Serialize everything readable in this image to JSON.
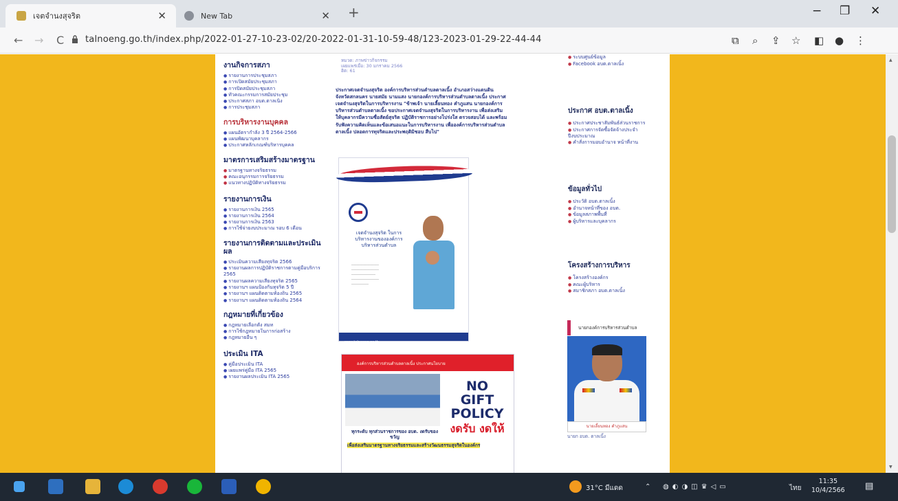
{
  "browser": {
    "tabs": [
      {
        "title": "เจตจำนงสุจริต"
      },
      {
        "title": "New Tab"
      }
    ],
    "new_tab_symbol": "+",
    "url": "talnoeng.go.th/index.php/2022-01-27-10-23-02/20-2022-01-31-10-59-48/123-2023-01-29-22-44-44",
    "nav": {
      "back": "←",
      "forward": "→",
      "reload": "C"
    },
    "window": {
      "minimize": "−",
      "maximize": "❐",
      "close": "✕"
    },
    "toolbar_icons": [
      "translate-icon",
      "zoom-icon",
      "share-icon",
      "bookmark-star-icon",
      "sidebar-icon",
      "profile-icon",
      "menu-icon"
    ]
  },
  "left_column": {
    "sections": [
      {
        "heading": "งานกิจการสภา",
        "links": [
          "รายงานการประชุมสภา",
          "การเปิดสมัยประชุมสภา",
          "การปิดสมัยประชุมสภา",
          "ทั่วคณะกรรมการสมัยประชุม",
          "ประกาศสภา อบต.ตาลเนิ้ง",
          "การประชุมสภา"
        ]
      },
      {
        "heading": "การบริหารงานบุคคล",
        "red": true,
        "links": [
          "แผนอัตรากำลัง 3 ปี 2564-2566",
          "แผนพัฒนาบุคลากร",
          "ประกาศหลักเกณฑ์บริหารบุคคล"
        ]
      },
      {
        "heading": "มาตรการเสริมสร้างมาตรฐาน",
        "links": [
          "มาตรฐานทางจริยธรรม",
          "คณะอนุกรรมการจริยธรรม",
          "แนวทางปฏิบัติทางจริยธรรม"
        ],
        "red_bullets": true
      },
      {
        "heading": "รายงานการเงิน",
        "links": [
          "รายงานการเงิน 2565",
          "รายงานการเงิน 2564",
          "รายงานการเงิน 2563",
          "การใช้จ่ายงบประมาณ รอบ 6 เดือน"
        ]
      },
      {
        "heading": "รายงานการติดตามและประเมินผล",
        "links": [
          "ประเมินความเสี่ยงทุจริต 2566",
          "รายงานผลการปฏิบัติราชการตามคู่มือบริการ 2565",
          "รายงานผลความเสี่ยงทุจริต 2565",
          "รายงานฯ แผนป้องกันทุจริต 5 ปี",
          "รายงานฯ แผนติดตามท้องถิ่น 2565",
          "รายงานฯ แผนติดตามท้องถิ่น 2564"
        ]
      },
      {
        "heading": "กฎหมายที่เกี่ยวข้อง",
        "links": [
          "กฎหมายเลือกตั้ง สมท",
          "การใช้กฎหมายในการก่อสร้าง",
          "กฎหมายอื่น ๆ"
        ]
      },
      {
        "heading": "ประเมิน ITA",
        "links": [
          "คู่มือประเมิน ITA",
          "เผยแพร่คู่มือ ITA 2565",
          "รายงานผลประเมิน ITA 2565"
        ]
      }
    ]
  },
  "article": {
    "meta": [
      "หมวด: ภาพข่าวกิจกรรม",
      "เผยแพร่เมื่อ: 30 มกราคม 2566",
      "ฮิต: 61"
    ],
    "paragraph": "ประกาศเจตจำนงสุจริต องค์การบริหารส่วนตำบลตาลเนิ้ง อำเภอสว่างแดนดิน จังหวัดสกลนคร นายสมัย นามแสง นายกองค์การบริหารส่วนตำบลตาลเนิ้ง ประกาศเจตจำนงสุจริตในการบริหารงาน \"ข้าพเจ้า นายเลี้ยนทอง คำภูแสน นายกองค์การบริหารส่วนตำบลตาลเนิ้ง ขอประกาศเจตจำนงสุจริตในการบริหารงาน เพื่อส่งเสริมให้บุคลากรมีความซื่อสัตย์สุจริต ปฏิบัติราชการอย่างโปร่งใส ตรวจสอบได้ และพร้อมรับฟังความคิดเห็นและข้อเสนอแนะในการบริหารงาน เพื่อองค์การบริหารส่วนตำบลตาลเนิ้ง ปลอดการทุจริตและประพฤติมิชอบ สืบไป\"",
    "poster1": {
      "title": "เจตจำนงสุจริต ในการบริหารงานขององค์การบริหารส่วนตำบล",
      "footer": "www.talnoeng.go.th"
    },
    "poster2": {
      "banner": "องค์การบริหารส่วนตำบลตาลเนิ้ง ประกาศนโยบาย",
      "headline": [
        "NO",
        "GIFT",
        "POLICY"
      ],
      "subhead": "งดรับ งดให้",
      "caption1": "ทุกระดับ ทุกส่วนราชการของ อบต. งดรับของขวัญ",
      "caption2": "เพื่อส่งเสริมมาตรฐานทางจริยธรรมและสร้างวัฒนธรรมสุจริตในองค์กร"
    }
  },
  "right_column": {
    "top_links": [
      "ระบบศูนย์ข้อมูล",
      "Facebook อบต.ตาลเนิ้ง"
    ],
    "sections": [
      {
        "heading": "ประกาศ อบต.ตาลเนิ้ง",
        "links": [
          "ประกาศประชาสัมพันธ์ส่วนราชการ",
          "ประกาศการจัดซื้อจัดจ้างประจำปีงบประมาณ",
          "คำสั่งการมอบอำนาจ หน้าที่งาน"
        ]
      },
      {
        "heading": "ข้อมูลทั่วไป",
        "links": [
          "ประวัติ อบต.ตาลเนิ้ง",
          "อำนาจหน้าที่ของ อบต.",
          "ข้อมูลสภาพพื้นที่",
          "ผู้บริหารและบุคลากร"
        ]
      },
      {
        "heading": "โครงสร้างการบริหาร",
        "links": [
          "โครงสร้างองค์กร",
          "คณะผู้บริหาร",
          "สมาชิกสภา อบต.ตาลเนิ้ง"
        ]
      }
    ],
    "portrait_tag": "นายกองค์การบริหารส่วนตำบล",
    "portrait_name": "นายเลี้ยนทอง คำภูแสน",
    "portrait_caption": "นายก อบต. ตาลเนิ้ง"
  },
  "taskbar": {
    "weather": "31°C มีแดด",
    "lang": "ไทย",
    "time": "11:35",
    "date": "10/4/2566",
    "apps": [
      "windows-start-icon",
      "mail-icon",
      "file-explorer-icon",
      "edge-icon",
      "chrome-icon",
      "line-icon",
      "word-icon",
      "chrome-icon"
    ]
  }
}
